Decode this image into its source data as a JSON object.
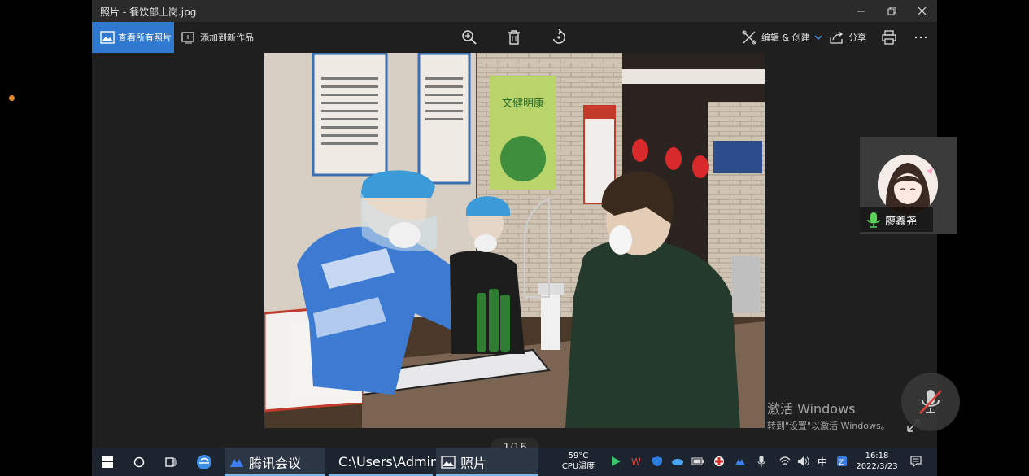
{
  "window": {
    "title": "照片 - 餐饮部上岗.jpg"
  },
  "toolbar": {
    "view_all": "查看所有照片",
    "add_to_creation": "添加到新作品",
    "edit_create": "编辑 & 创建",
    "share": "分享"
  },
  "viewer": {
    "counter": "1/16"
  },
  "watermark": {
    "line1": "激活 Windows",
    "line2": "转到\"设置\"以激活 Windows。"
  },
  "meeting": {
    "participant_name": "廖鑫尧"
  },
  "photo_text": {
    "poster_top": "文健明康"
  },
  "taskbar": {
    "tencent_meeting": "腾讯会议",
    "explorer": "C:\\Users\\Adminis...",
    "photos": "照片",
    "temp_value": "59°C",
    "temp_label": "CPU温度",
    "ime": "中",
    "time": "16:18",
    "date": "2022/3/23"
  },
  "colors": {
    "accent": "#2f79d1",
    "taskbar": "#1c2430",
    "mic_green": "#5ad15a",
    "mute_red": "#e0403a"
  }
}
